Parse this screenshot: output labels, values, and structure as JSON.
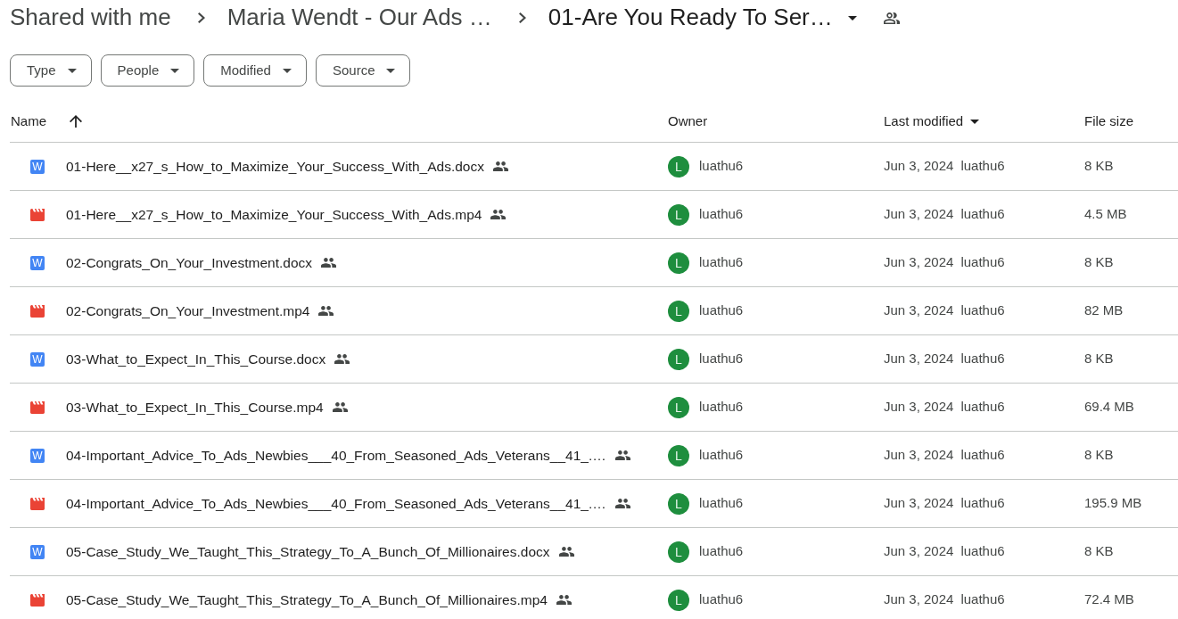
{
  "breadcrumbs": [
    {
      "label": "Shared with me",
      "current": false
    },
    {
      "label": "Maria Wendt - Our Ads …",
      "current": false
    },
    {
      "label": "01-Are You Ready To Ser…",
      "current": true
    }
  ],
  "folder_shared": true,
  "filters": [
    {
      "label": "Type"
    },
    {
      "label": "People"
    },
    {
      "label": "Modified"
    },
    {
      "label": "Source"
    }
  ],
  "table": {
    "columns": [
      {
        "label": "Name",
        "sort_arrow": true,
        "menu": false
      },
      {
        "label": "Owner",
        "sort_arrow": false,
        "menu": false
      },
      {
        "label": "Last modified",
        "sort_arrow": false,
        "menu": true
      },
      {
        "label": "File size",
        "sort_arrow": false,
        "menu": false
      }
    ],
    "rows": [
      {
        "kind": "document",
        "icon_letter": "W",
        "name": "01-Here__x27_s_How_to_Maximize_Your_Success_With_Ads.docx",
        "shared": true,
        "owner_initial": "L",
        "owner": "luathu6",
        "modified": "Jun 3, 2024",
        "modified_by": "luathu6",
        "size": "8 KB"
      },
      {
        "kind": "video",
        "name": "01-Here__x27_s_How_to_Maximize_Your_Success_With_Ads.mp4",
        "shared": true,
        "owner_initial": "L",
        "owner": "luathu6",
        "modified": "Jun 3, 2024",
        "modified_by": "luathu6",
        "size": "4.5 MB"
      },
      {
        "kind": "document",
        "icon_letter": "W",
        "name": "02-Congrats_On_Your_Investment.docx",
        "shared": true,
        "owner_initial": "L",
        "owner": "luathu6",
        "modified": "Jun 3, 2024",
        "modified_by": "luathu6",
        "size": "8 KB"
      },
      {
        "kind": "video",
        "name": "02-Congrats_On_Your_Investment.mp4",
        "shared": true,
        "owner_initial": "L",
        "owner": "luathu6",
        "modified": "Jun 3, 2024",
        "modified_by": "luathu6",
        "size": "82 MB"
      },
      {
        "kind": "document",
        "icon_letter": "W",
        "name": "03-What_to_Expect_In_This_Course.docx",
        "shared": true,
        "owner_initial": "L",
        "owner": "luathu6",
        "modified": "Jun 3, 2024",
        "modified_by": "luathu6",
        "size": "8 KB"
      },
      {
        "kind": "video",
        "name": "03-What_to_Expect_In_This_Course.mp4",
        "shared": true,
        "owner_initial": "L",
        "owner": "luathu6",
        "modified": "Jun 3, 2024",
        "modified_by": "luathu6",
        "size": "69.4 MB"
      },
      {
        "kind": "document",
        "icon_letter": "W",
        "name": "04-Important_Advice_To_Ads_Newbies___40_From_Seasoned_Ads_Veterans__41_.…",
        "shared": true,
        "owner_initial": "L",
        "owner": "luathu6",
        "modified": "Jun 3, 2024",
        "modified_by": "luathu6",
        "size": "8 KB"
      },
      {
        "kind": "video",
        "name": "04-Important_Advice_To_Ads_Newbies___40_From_Seasoned_Ads_Veterans__41_.…",
        "shared": true,
        "owner_initial": "L",
        "owner": "luathu6",
        "modified": "Jun 3, 2024",
        "modified_by": "luathu6",
        "size": "195.9 MB"
      },
      {
        "kind": "document",
        "icon_letter": "W",
        "name": "05-Case_Study_We_Taught_This_Strategy_To_A_Bunch_Of_Millionaires.docx",
        "shared": true,
        "owner_initial": "L",
        "owner": "luathu6",
        "modified": "Jun 3, 2024",
        "modified_by": "luathu6",
        "size": "8 KB"
      },
      {
        "kind": "video",
        "name": "05-Case_Study_We_Taught_This_Strategy_To_A_Bunch_Of_Millionaires.mp4",
        "shared": true,
        "owner_initial": "L",
        "owner": "luathu6",
        "modified": "Jun 3, 2024",
        "modified_by": "luathu6",
        "size": "72.4 MB"
      }
    ]
  }
}
